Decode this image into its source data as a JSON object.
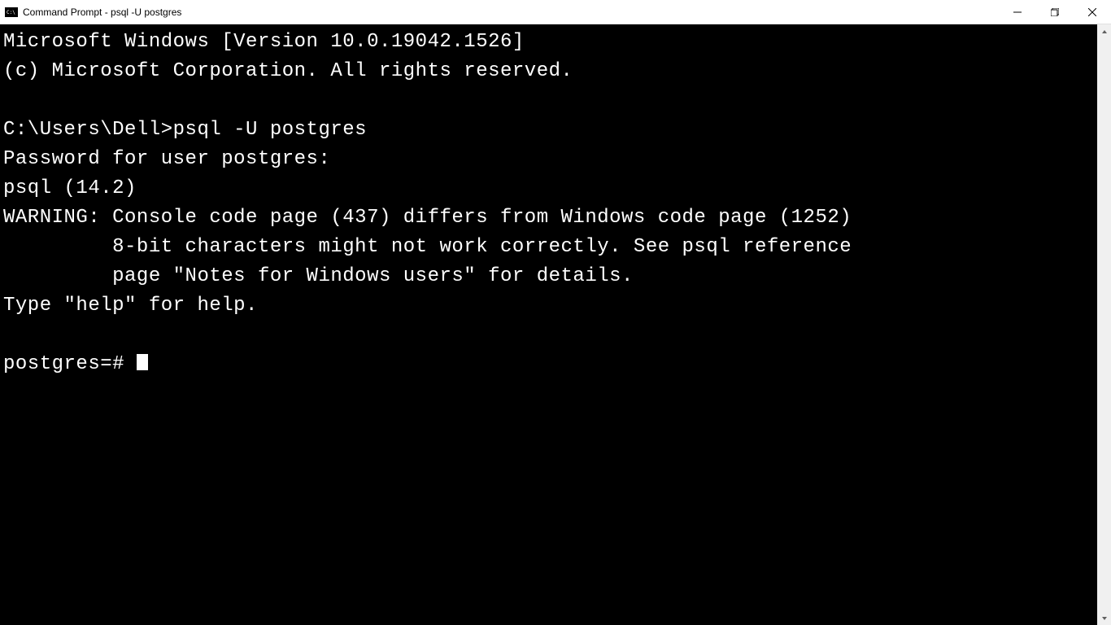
{
  "window": {
    "title": "Command Prompt - psql  -U postgres"
  },
  "terminal": {
    "lines": [
      "Microsoft Windows [Version 10.0.19042.1526]",
      "(c) Microsoft Corporation. All rights reserved.",
      "",
      "C:\\Users\\Dell>psql -U postgres",
      "Password for user postgres:",
      "psql (14.2)",
      "WARNING: Console code page (437) differs from Windows code page (1252)",
      "         8-bit characters might not work correctly. See psql reference",
      "         page \"Notes for Windows users\" for details.",
      "Type \"help\" for help.",
      ""
    ],
    "prompt": "postgres=# "
  }
}
